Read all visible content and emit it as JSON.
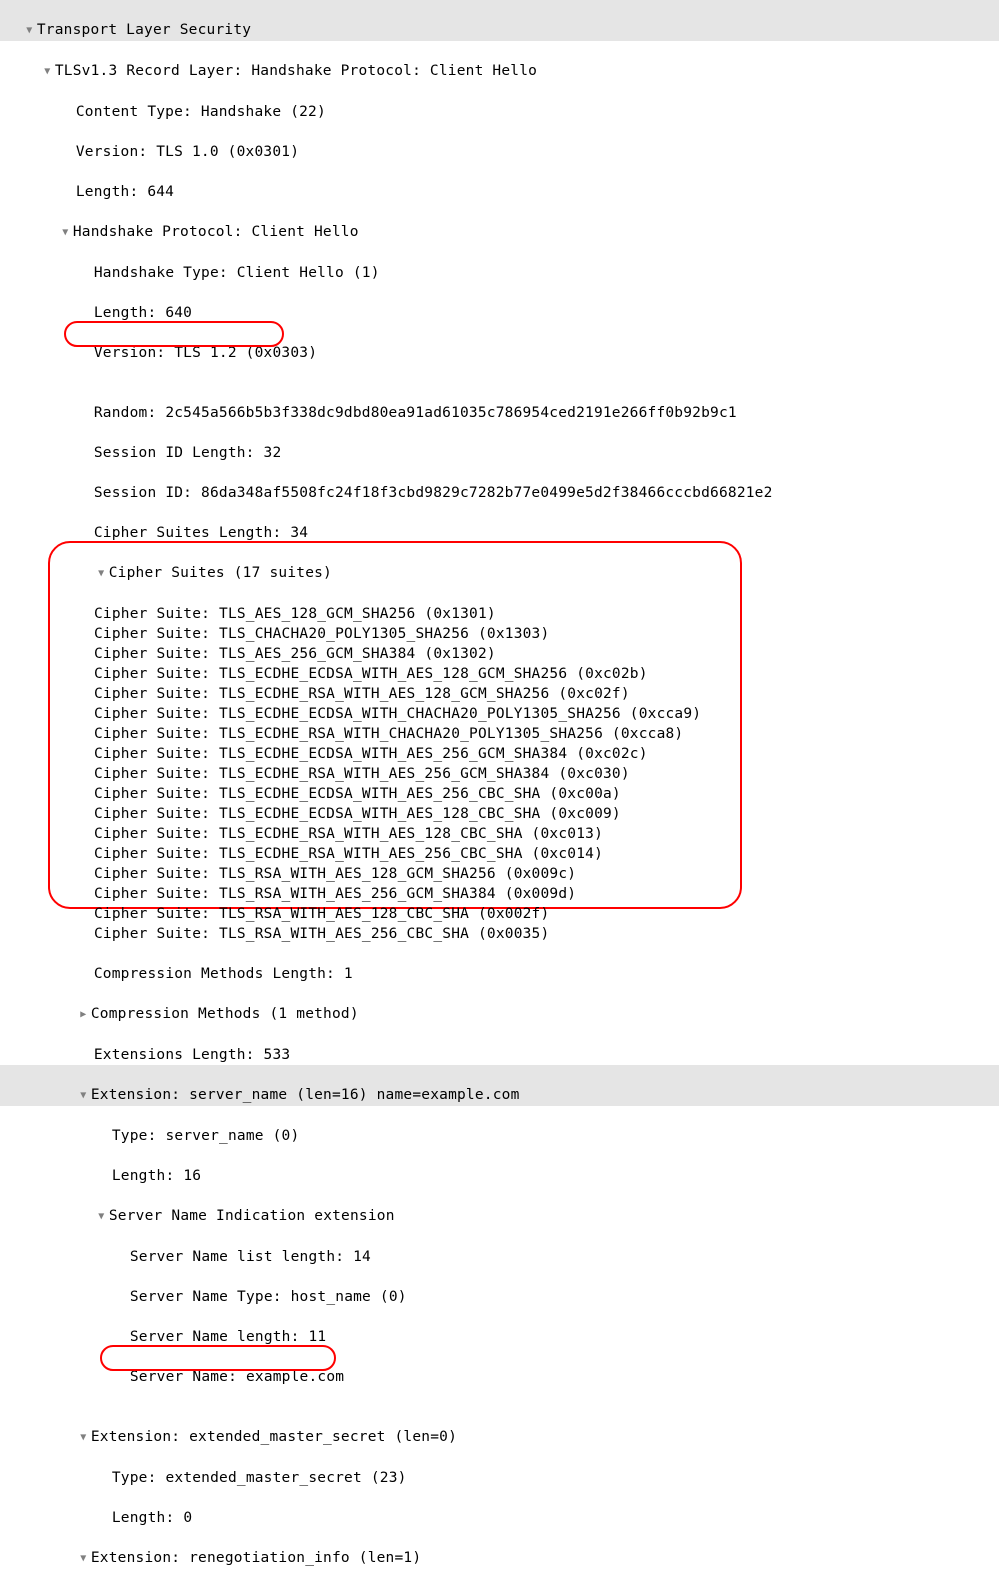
{
  "title": "Transport Layer Security",
  "record_layer": {
    "label": "TLSv1.3 Record Layer: Handshake Protocol: Client Hello",
    "content_type": "Content Type: Handshake (22)",
    "version": "Version: TLS 1.0 (0x0301)",
    "length": "Length: 644"
  },
  "handshake": {
    "label": "Handshake Protocol: Client Hello",
    "type": "Handshake Type: Client Hello (1)",
    "length": "Length: 640",
    "version": "Version: TLS 1.2 (0x0303)",
    "random": "Random: 2c545a566b5b3f338dc9dbd80ea91ad61035c786954ced2191e266ff0b92b9c1",
    "session_id_len": "Session ID Length: 32",
    "session_id": "Session ID: 86da348af5508fc24f18f3cbd9829c7282b77e0499e5d2f38466cccbd66821e2",
    "cipher_suites_len": "Cipher Suites Length: 34"
  },
  "cipher_suites_header": "Cipher Suites (17 suites)",
  "cipher_suites": [
    "Cipher Suite: TLS_AES_128_GCM_SHA256 (0x1301)",
    "Cipher Suite: TLS_CHACHA20_POLY1305_SHA256 (0x1303)",
    "Cipher Suite: TLS_AES_256_GCM_SHA384 (0x1302)",
    "Cipher Suite: TLS_ECDHE_ECDSA_WITH_AES_128_GCM_SHA256 (0xc02b)",
    "Cipher Suite: TLS_ECDHE_RSA_WITH_AES_128_GCM_SHA256 (0xc02f)",
    "Cipher Suite: TLS_ECDHE_ECDSA_WITH_CHACHA20_POLY1305_SHA256 (0xcca9)",
    "Cipher Suite: TLS_ECDHE_RSA_WITH_CHACHA20_POLY1305_SHA256 (0xcca8)",
    "Cipher Suite: TLS_ECDHE_ECDSA_WITH_AES_256_GCM_SHA384 (0xc02c)",
    "Cipher Suite: TLS_ECDHE_RSA_WITH_AES_256_GCM_SHA384 (0xc030)",
    "Cipher Suite: TLS_ECDHE_ECDSA_WITH_AES_256_CBC_SHA (0xc00a)",
    "Cipher Suite: TLS_ECDHE_ECDSA_WITH_AES_128_CBC_SHA (0xc009)",
    "Cipher Suite: TLS_ECDHE_RSA_WITH_AES_128_CBC_SHA (0xc013)",
    "Cipher Suite: TLS_ECDHE_RSA_WITH_AES_256_CBC_SHA (0xc014)",
    "Cipher Suite: TLS_RSA_WITH_AES_128_GCM_SHA256 (0x009c)",
    "Cipher Suite: TLS_RSA_WITH_AES_256_GCM_SHA384 (0x009d)",
    "Cipher Suite: TLS_RSA_WITH_AES_128_CBC_SHA (0x002f)",
    "Cipher Suite: TLS_RSA_WITH_AES_256_CBC_SHA (0x0035)"
  ],
  "compression": {
    "length": "Compression Methods Length: 1",
    "methods": "Compression Methods (1 method)"
  },
  "extensions_length": "Extensions Length: 533",
  "ext_server_name": {
    "header": "Extension: server_name (len=16) name=example.com",
    "type": "Type: server_name (0)",
    "length": "Length: 16",
    "sni_header": "Server Name Indication extension",
    "list_length": "Server Name list length: 14",
    "name_type": "Server Name Type: host_name (0)",
    "name_length": "Server Name length: 11",
    "server_name": "Server Name: example.com"
  },
  "ext_ems": {
    "header": "Extension: extended_master_secret (len=0)",
    "type": "Type: extended_master_secret (23)",
    "length": "Length: 0"
  },
  "ext_reneg": {
    "header": "Extension: renegotiation_info (len=1)"
  }
}
